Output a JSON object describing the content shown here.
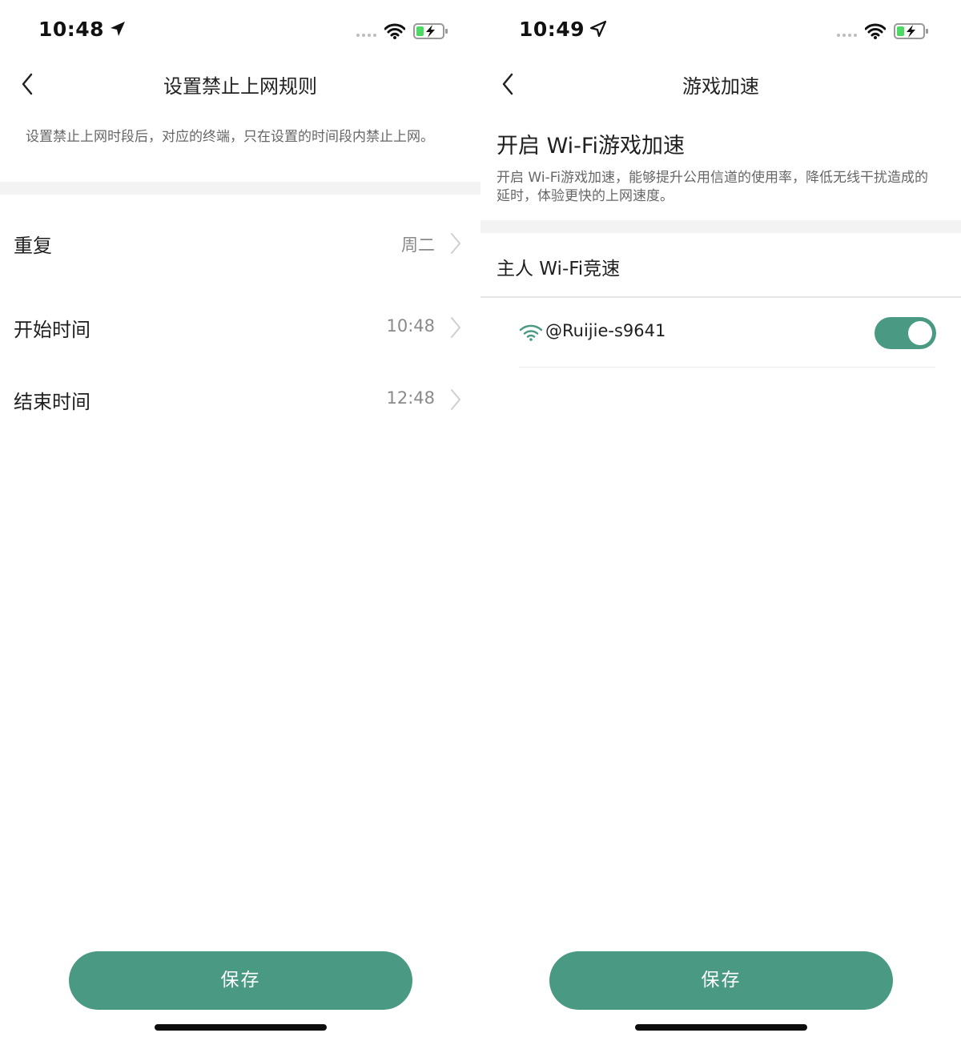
{
  "colors": {
    "accent": "#4a9a83",
    "battery": "#4cd964",
    "band": "#f3f3f3"
  },
  "left_screen": {
    "status_time": "10:48",
    "nav_title": "设置禁止上网规则",
    "description": "设置禁止上网时段后，对应的终端，只在设置的时间段内禁止上网。",
    "rows": [
      {
        "label": "重复",
        "value": "周二"
      },
      {
        "label": "开始时间",
        "value": "10:48"
      },
      {
        "label": "结束时间",
        "value": "12:48"
      }
    ],
    "save_label": "保存"
  },
  "right_screen": {
    "status_time": "10:49",
    "nav_title": "游戏加速",
    "section_title": "开启 Wi-Fi游戏加速",
    "section_desc": "开启 Wi-Fi游戏加速，能够提升公用信道的使用率，降低无线干扰造成的延时，体验更快的上网速度。",
    "sub_title": "主人 Wi-Fi竞速",
    "wifi_item": {
      "name": "@Ruijie-s9641",
      "toggle_on": true
    },
    "save_label": "保存"
  },
  "icons": [
    "location-arrow-icon",
    "cellular-signal-icon",
    "wifi-icon",
    "battery-charging-icon",
    "back-chevron-icon",
    "chevron-right-icon",
    "wifi-signal-icon"
  ]
}
